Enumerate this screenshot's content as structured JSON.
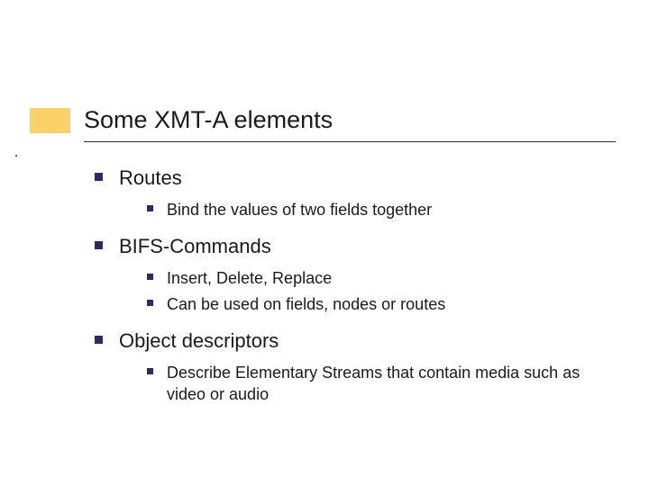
{
  "slide": {
    "title": "Some XMT-A elements",
    "sections": [
      {
        "heading": "Routes",
        "items": [
          "Bind the values of two fields together"
        ]
      },
      {
        "heading": "BIFS-Commands",
        "items": [
          "Insert, Delete, Replace",
          "Can be used on fields, nodes or routes"
        ]
      },
      {
        "heading": "Object descriptors",
        "items": [
          "Describe Elementary Streams that contain media such as video or audio"
        ]
      }
    ]
  }
}
